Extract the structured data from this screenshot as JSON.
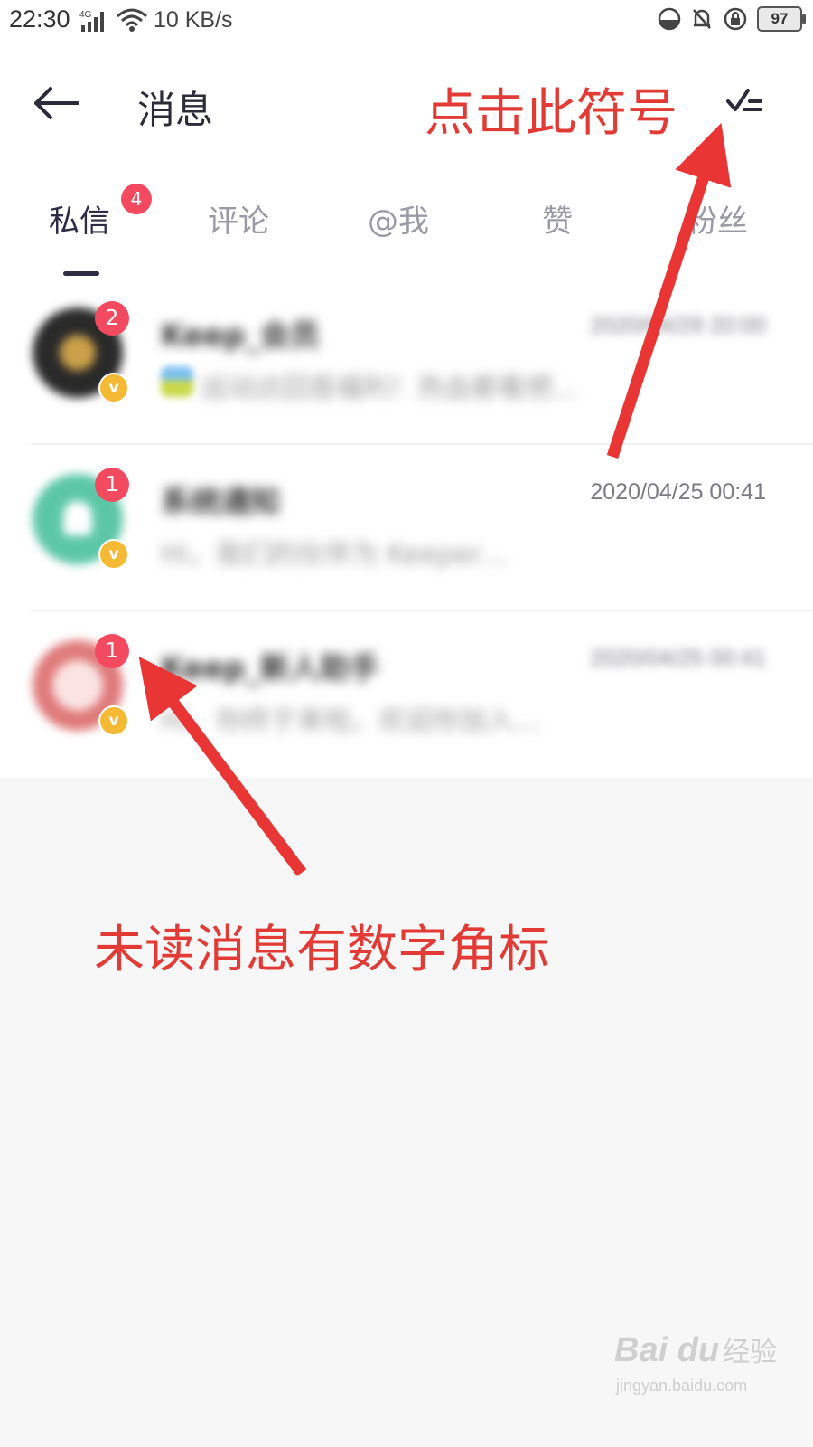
{
  "status_bar": {
    "time": "22:30",
    "network_type": "4G",
    "net_speed": "10 KB/s",
    "battery": "97"
  },
  "header": {
    "title": "消息",
    "back_icon": "arrow-left-icon",
    "mark_read_icon": "check-list-icon"
  },
  "tabs": [
    {
      "label": "私信",
      "active": true,
      "badge": "4"
    },
    {
      "label": "评论"
    },
    {
      "label": "@我"
    },
    {
      "label": "赞"
    },
    {
      "label": "粉丝"
    }
  ],
  "messages": [
    {
      "name": "Keep_会员",
      "time": "2020/04/29 20:00",
      "preview": "运动达回首福利！热血都看燃…",
      "unread": "2",
      "avatar_color": "#2a2a2a"
    },
    {
      "name": "系统通知",
      "time": "2020/04/25 00:41",
      "preview": "Hi，我们的伙伴为 Keeper…",
      "unread": "1",
      "avatar_color": "#5cc7a6"
    },
    {
      "name": "Keep_新人助手",
      "time": "2020/04/25 00:41",
      "preview": "Hi，你终于来啦，欢迎你加入…",
      "unread": "1",
      "avatar_color": "#e07a7a"
    }
  ],
  "vip_badge": "v",
  "annotations": {
    "top": "点击此符号",
    "bottom": "未读消息有数字角标"
  },
  "watermark": {
    "logo": "Bai du",
    "cn": "经验",
    "url": "jingyan.baidu.com"
  },
  "colors": {
    "badge": "#f44a5f",
    "annotation": "#e23a34",
    "vip": "#f6b934"
  }
}
